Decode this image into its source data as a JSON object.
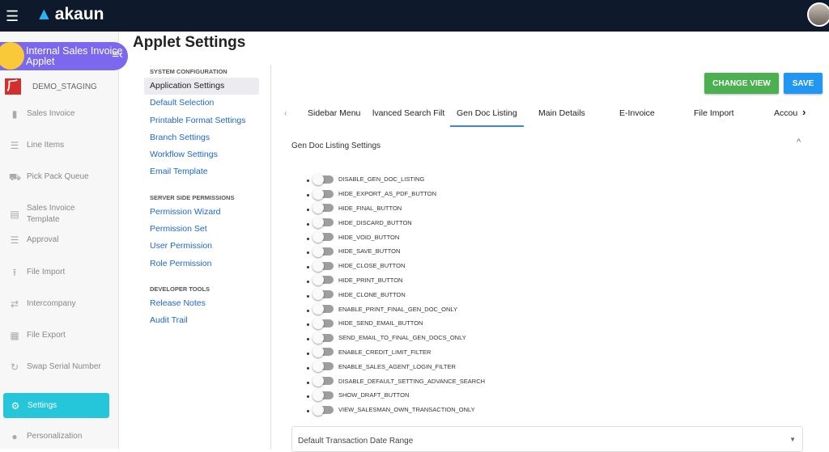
{
  "topbar": {
    "brand": "akaun"
  },
  "sidebar": {
    "applet_name": "Internal Sales Invoice Applet",
    "org": "DEMO_STAGING",
    "items": [
      {
        "label": "Sales Invoice",
        "icon": "▮"
      },
      {
        "label": "Line Items",
        "icon": "☰"
      },
      {
        "label": "Pick Pack Queue",
        "icon": "⛟"
      },
      {
        "label": "Sales Invoice Template",
        "icon": "▤"
      },
      {
        "label": "Approval",
        "icon": "☰"
      },
      {
        "label": "File Import",
        "icon": "⭱"
      },
      {
        "label": "Intercompany",
        "icon": "⇄"
      },
      {
        "label": "File Export",
        "icon": "▦"
      },
      {
        "label": "Swap Serial Number",
        "icon": "↻"
      },
      {
        "label": "Settings",
        "icon": "⚙"
      },
      {
        "label": "Personalization",
        "icon": "●"
      }
    ]
  },
  "page": {
    "title": "Applet Settings"
  },
  "subnav": {
    "system_title": "SYSTEM CONFIGURATION",
    "system": [
      "Application Settings",
      "Default Selection",
      "Printable Format Settings",
      "Branch Settings",
      "Workflow Settings",
      "Email Template"
    ],
    "server_title": "SERVER SIDE PERMISSIONS",
    "server": [
      "Permission Wizard",
      "Permission Set",
      "User Permission",
      "Role Permission"
    ],
    "dev_title": "DEVELOPER TOOLS",
    "dev": [
      "Release Notes",
      "Audit Trail"
    ]
  },
  "main": {
    "change_view": "CHANGE VIEW",
    "save": "SAVE",
    "tabs": [
      "Sidebar Menu",
      "lvanced Search Filt",
      "Gen Doc Listing",
      "Main Details",
      "E-Invoice",
      "File Import",
      "Accou"
    ],
    "panel_title": "Gen Doc Listing Settings",
    "toggles": [
      "DISABLE_GEN_DOC_LISTING",
      "HIDE_EXPORT_AS_PDF_BUTTON",
      "HIDE_FINAL_BUTTON",
      "HIDE_DISCARD_BUTTON",
      "HIDE_VOID_BUTTON",
      "HIDE_SAVE_BUTTON",
      "HIDE_CLOSE_BUTTON",
      "HIDE_PRINT_BUTTON",
      "HIDE_CLONE_BUTTON",
      "ENABLE_PRINT_FINAL_GEN_DOC_ONLY",
      "HIDE_SEND_EMAIL_BUTTON",
      "SEND_EMAIL_TO_FINAL_GEN_DOCS_ONLY",
      "ENABLE_CREDIT_LIMIT_FILTER",
      "ENABLE_SALES_AGENT_LOGIN_FILTER",
      "DISABLE_DEFAULT_SETTING_ADVANCE_SEARCH",
      "SHOW_DRAFT_BUTTON",
      "VIEW_SALESMAN_OWN_TRANSACTION_ONLY"
    ],
    "select_label": "Default Transaction Date Range"
  }
}
